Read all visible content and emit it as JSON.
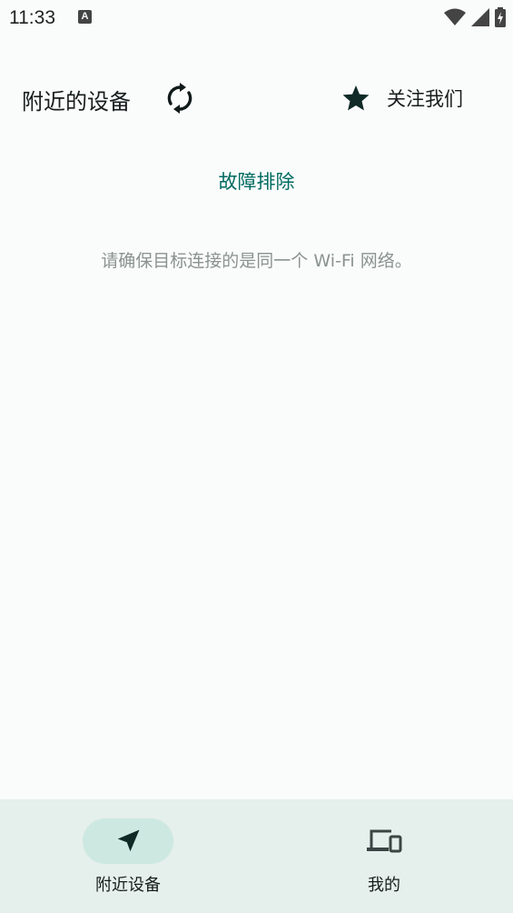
{
  "status_bar": {
    "time": "11:33",
    "notification_icon": "a-letter-icon",
    "right_icons": [
      "wifi-icon",
      "signal-icon",
      "battery-charging-icon"
    ]
  },
  "header": {
    "title": "附近的设备",
    "refresh_icon": "refresh-icon",
    "follow_label": "关注我们",
    "follow_icon": "star-icon"
  },
  "content": {
    "troubleshoot_label": "故障排除",
    "hint_text": "请确保目标连接的是同一个 Wi-Fi 网络。"
  },
  "bottom_nav": {
    "items": [
      {
        "label": "附近设备",
        "icon": "navigation-arrow-icon",
        "selected": true
      },
      {
        "label": "我的",
        "icon": "devices-icon",
        "selected": false
      }
    ]
  },
  "colors": {
    "background": "#fafcfb",
    "accent": "#006a60",
    "nav_background": "#e5efeb",
    "nav_selected_pill": "#cce8e1",
    "icon_dark": "#0f2a26"
  }
}
